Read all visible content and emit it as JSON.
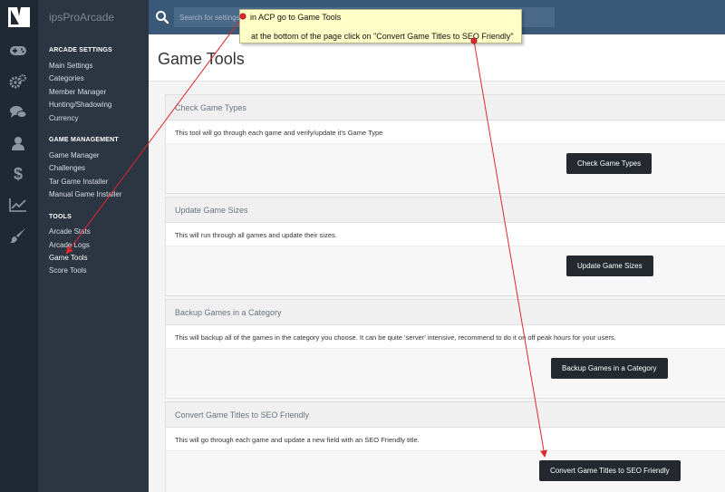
{
  "app": {
    "title": "ipsProArcade"
  },
  "search": {
    "placeholder": "Search for settings"
  },
  "nav": {
    "sections": [
      {
        "heading": "ARCADE SETTINGS",
        "items": [
          "Main Settings",
          "Categories",
          "Member Manager",
          "Hunting/Shadowing",
          "Currency"
        ]
      },
      {
        "heading": "GAME MANAGEMENT",
        "items": [
          "Game Manager",
          "Challenges",
          "Tar Game Installer",
          "Manual Game Installer"
        ]
      },
      {
        "heading": "TOOLS",
        "items": [
          "Arcade Stats",
          "Arcade Logs",
          "Game Tools",
          "Score Tools"
        ]
      }
    ]
  },
  "rail_icons": [
    "gamepad-icon",
    "gears-icon",
    "comments-icon",
    "user-icon",
    "dollar-icon",
    "line-chart-icon",
    "paint-brush-icon"
  ],
  "page": {
    "title": "Game Tools"
  },
  "panels": [
    {
      "header": "Check Game Types",
      "description": "This tool will go through each game and verify/update it's Game Type",
      "button": "Check Game Types"
    },
    {
      "header": "Update Game Sizes",
      "description": "This will run through all games and update their sizes.",
      "button": "Update Game Sizes"
    },
    {
      "header": "Backup Games in a Category",
      "description": "This will backup all of the games in the category you choose. It can be quite 'server' intensive, recommend to do it on off peak hours for your users.",
      "button": "Backup Games in a Category"
    },
    {
      "header": "Convert Game Titles to SEO Friendly",
      "description": "This will go through each game and update a new field with an SEO Friendly title.",
      "button": "Convert Game Titles to SEO Friendly"
    }
  ],
  "annotation": {
    "line1": "in ACP go to Game Tools",
    "line2": "at the bottom of the page click on \"Convert Game Titles to SEO Friendly\""
  },
  "colors": {
    "rail": "#1f2833",
    "nav": "#2c3642",
    "topbar": "#3a5877",
    "button": "#23292f",
    "arrow": "#e0282c",
    "note": "#ffffc8"
  }
}
